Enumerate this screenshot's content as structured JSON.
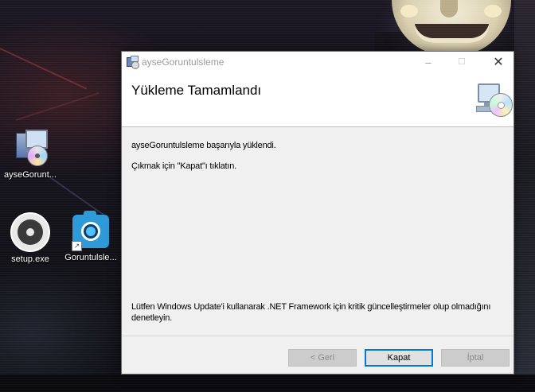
{
  "desktop": {
    "icons": [
      {
        "label": "ayseGorunt...",
        "icon": "installer-package-icon"
      },
      {
        "label": "setup.exe",
        "icon": "disc-setup-icon"
      },
      {
        "label": "Goruntulsle...",
        "icon": "camera-app-icon"
      }
    ]
  },
  "window": {
    "title": "ayseGoruntulsleme",
    "controls": {
      "minimize": "–",
      "maximize": "☐",
      "close": "✕"
    },
    "header_title": "Yükleme Tamamlandı",
    "message_success": "ayseGoruntulsleme başarıyla yüklendi.",
    "message_exit": "Çıkmak için \"Kapat\"ı tıklatın.",
    "message_update": "Lütfen Windows Update'i kullanarak .NET Framework için kritik güncelleştirmeler olup olmadığını denetleyin.",
    "buttons": {
      "back": "< Geri",
      "close": "Kapat",
      "cancel": "İptal"
    },
    "colors": {
      "focus_border": "#0078d7",
      "disabled_bg": "#cccccc"
    }
  }
}
